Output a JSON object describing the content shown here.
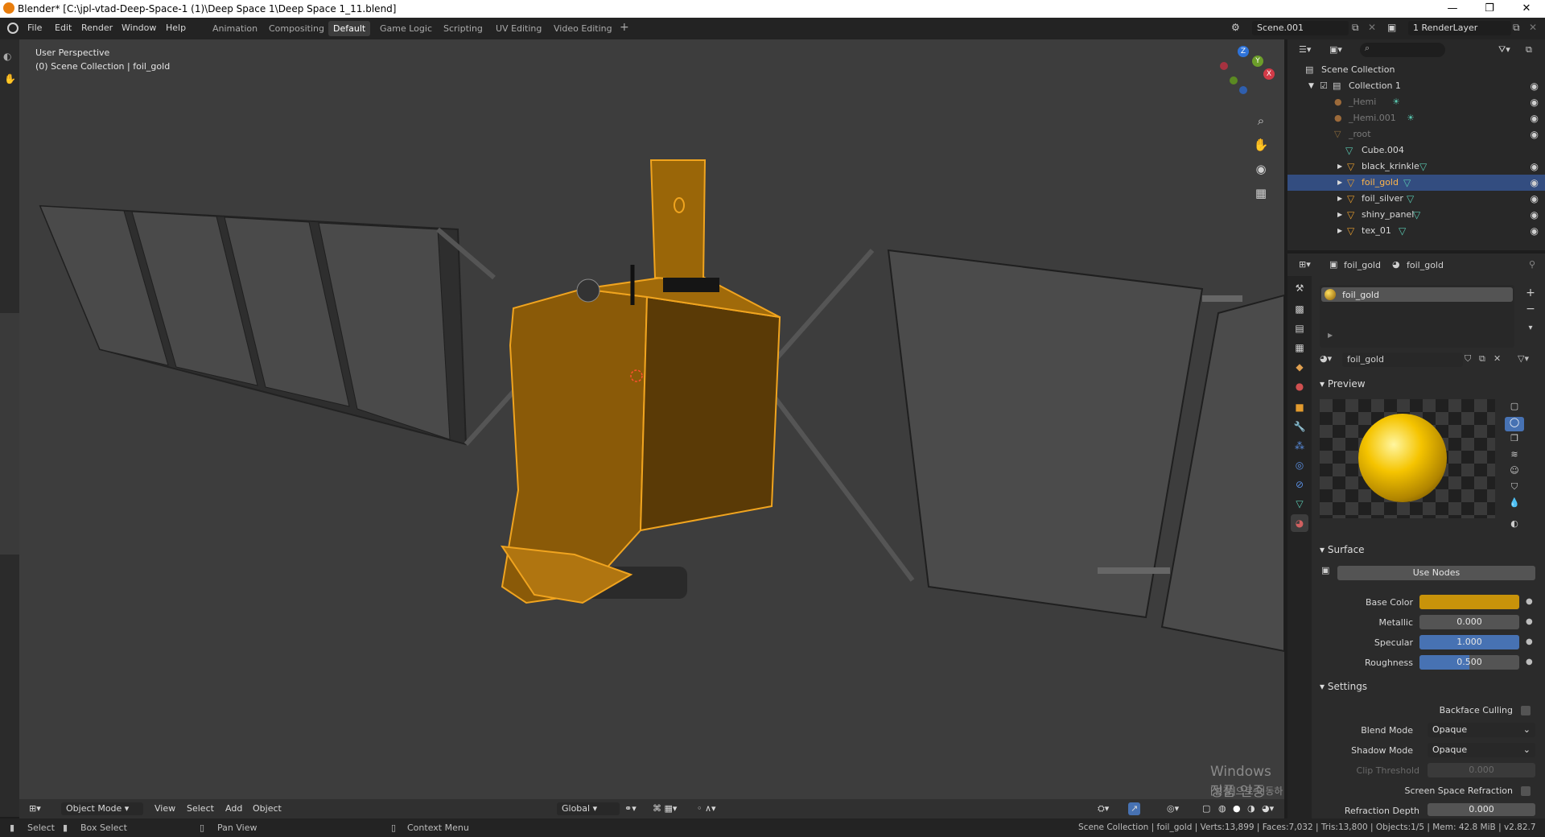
{
  "window": {
    "title": "Blender* [C:\\jpl-vtad-Deep-Space-1 (1)\\Deep Space 1\\Deep Space 1_11.blend]",
    "minimize": "—",
    "maximize": "❐",
    "close": "✕"
  },
  "menu": [
    "File",
    "Edit",
    "Render",
    "Window",
    "Help"
  ],
  "workspaces": [
    {
      "label": "Animation",
      "active": false
    },
    {
      "label": "Compositing",
      "active": false
    },
    {
      "label": "Default",
      "active": true
    },
    {
      "label": "Game Logic",
      "active": false
    },
    {
      "label": "Scripting",
      "active": false
    },
    {
      "label": "UV Editing",
      "active": false
    },
    {
      "label": "Video Editing",
      "active": false
    }
  ],
  "workspace_add": "+",
  "scene": "Scene.001",
  "render_layer": "1 RenderLayer",
  "viewport": {
    "perspective": "User Perspective",
    "collection_info": "(0) Scene Collection | foil_gold",
    "gizmo": {
      "x": "X",
      "y": "Y",
      "z": "Z"
    },
    "footer": {
      "mode": "Object Mode",
      "view": "View",
      "select": "Select",
      "add": "Add",
      "object": "Object",
      "orientation": "Global"
    }
  },
  "outliner": {
    "root": "Scene Collection",
    "collection": "Collection 1",
    "items": [
      {
        "name": "_Hemi",
        "dim": true
      },
      {
        "name": "_Hemi.001",
        "dim": true
      },
      {
        "name": "_root",
        "dim": true
      },
      {
        "name": "Cube.004",
        "dim": false
      },
      {
        "name": "black_krinkle",
        "dim": false
      },
      {
        "name": "foil_gold",
        "dim": false,
        "selected": true
      },
      {
        "name": "foil_silver",
        "dim": false
      },
      {
        "name": "shiny_panel",
        "dim": false
      },
      {
        "name": "tex_01",
        "dim": false
      }
    ]
  },
  "properties": {
    "object_name": "foil_gold",
    "material_name": "foil_gold",
    "slot_name": "foil_gold",
    "material_field": "foil_gold",
    "preview_header": "Preview",
    "surface_header": "Surface",
    "use_nodes": "Use Nodes",
    "base_color_label": "Base Color",
    "base_color": "#c8930a",
    "metallic_label": "Metallic",
    "metallic": "0.000",
    "specular_label": "Specular",
    "specular": "1.000",
    "specular_fraction": 1.0,
    "roughness_label": "Roughness",
    "roughness": "0.500",
    "roughness_fraction": 0.5,
    "settings_header": "Settings",
    "backface_culling": "Backface Culling",
    "blend_mode_label": "Blend Mode",
    "blend_mode": "Opaque",
    "shadow_mode_label": "Shadow Mode",
    "shadow_mode": "Opaque",
    "clip_threshold_label": "Clip Threshold",
    "clip_threshold": "0.000",
    "ssr_label": "Screen Space Refraction",
    "refraction_depth_label": "Refraction Depth",
    "refraction_depth": "0.000"
  },
  "watermark": {
    "line1": "Windows 정품 인증",
    "line2": "[설정]으로 이동하여 Windows를 정품 인증합니다."
  },
  "statusbar": {
    "select": "Select",
    "box_select": "Box Select",
    "pan_view": "Pan View",
    "context_menu": "Context Menu",
    "stats": "Scene Collection | foil_gold | Verts:13,899 | Faces:7,032 | Tris:13,800 | Objects:1/5 | Mem: 42.8 MiB | v2.82.7"
  },
  "colors": {
    "selection_orange": "#e39b2e",
    "viewport_bg": "#3d3d3d",
    "active_row": "#334d80",
    "slider_blue": "#4772b3"
  }
}
